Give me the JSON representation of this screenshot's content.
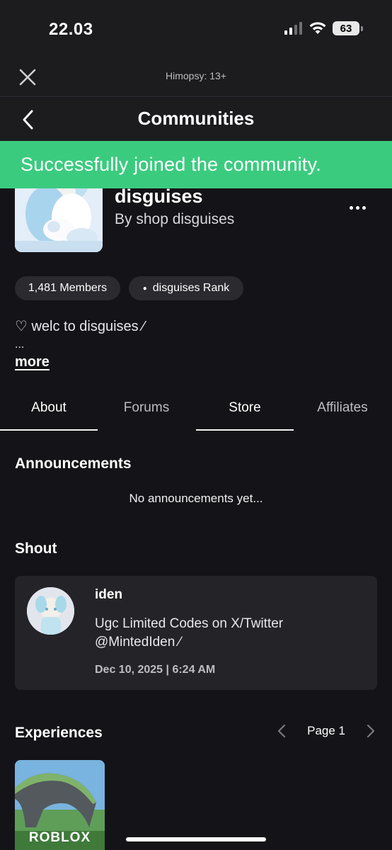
{
  "status_bar": {
    "time": "22.03",
    "battery": "63",
    "signal_icon": "cellular-signal-icon",
    "wifi_icon": "wifi-icon"
  },
  "top_bar": {
    "title": "Himopsy: 13+",
    "close_icon": "close-icon"
  },
  "nav": {
    "title": "Communities",
    "back_icon": "chevron-left-icon"
  },
  "toast": {
    "message": "Successfully joined the community.",
    "color": "#3bcb7f"
  },
  "community": {
    "name": "disguises",
    "owner": "By shop disguises",
    "members": "1,481 Members",
    "rank": "disguises Rank",
    "description": "♡ welc to disguises ⁄",
    "description_more": "...",
    "more_label": "more"
  },
  "tabs": [
    {
      "label": "About",
      "active": true
    },
    {
      "label": "Forums",
      "active": false
    },
    {
      "label": "Store",
      "active": true
    },
    {
      "label": "Affiliates",
      "active": false
    }
  ],
  "announcements": {
    "title": "Announcements",
    "empty": "No announcements yet..."
  },
  "shout": {
    "title": "Shout",
    "user": "iden",
    "text": "Ugc Limited Codes on X/Twitter @MintedIden ⁄",
    "date": "Dec 10, 2025 | 6:24 AM"
  },
  "experiences": {
    "title": "Experiences",
    "page_label": "Page 1",
    "thumb_logo": "ROBLOX"
  }
}
